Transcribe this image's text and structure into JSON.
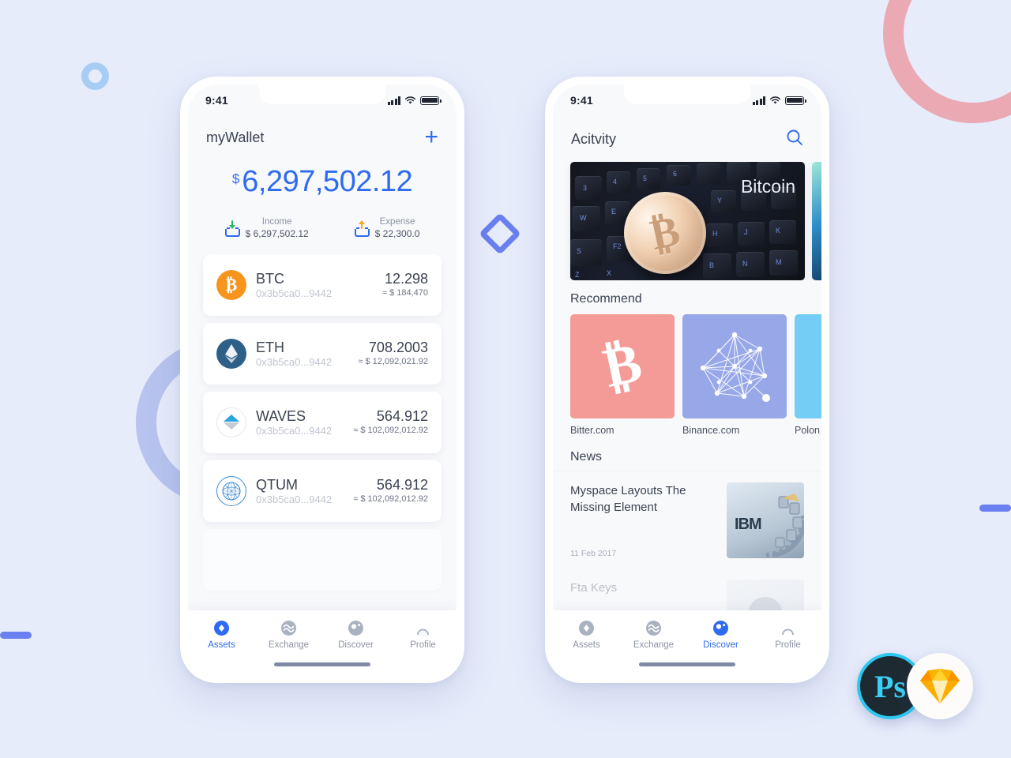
{
  "background": {
    "color": "#e7ecfb",
    "decorations": [
      {
        "name": "ring-pink",
        "color": "#eaa9b3"
      },
      {
        "name": "ring-blue-small",
        "color": "#a8cdf4"
      },
      {
        "name": "ring-periwinkle",
        "color": "#b8c4ef"
      },
      {
        "name": "bar-left",
        "color": "#6a7ff0"
      },
      {
        "name": "bar-right",
        "color": "#6a7ff0"
      },
      {
        "name": "diamond",
        "color": "#6a7ff0"
      }
    ]
  },
  "badges": [
    {
      "name": "photoshop",
      "label": "Ps"
    },
    {
      "name": "sketch",
      "label": "Sketch"
    }
  ],
  "phone1": {
    "status": {
      "time": "9:41"
    },
    "header": {
      "title": "myWallet",
      "add_label": "+"
    },
    "balance": {
      "currency": "$",
      "amount": "6,297,502.12"
    },
    "summary": [
      {
        "label": "Income",
        "value": "$ 6,297,502.12",
        "direction": "down",
        "color": "#28b865"
      },
      {
        "label": "Expense",
        "value": "$ 22,300.0",
        "direction": "up",
        "color": "#f5a623"
      }
    ],
    "assets": [
      {
        "symbol": "BTC",
        "address": "0x3b5ca0...9442",
        "amount": "12.298",
        "fiat": "≈ $ 184,470",
        "icon": "bitcoin-icon"
      },
      {
        "symbol": "ETH",
        "address": "0x3b5ca0...9442",
        "amount": "708.2003",
        "fiat": "≈ $ 12,092,021.92",
        "icon": "ethereum-icon"
      },
      {
        "symbol": "WAVES",
        "address": "0x3b5ca0...9442",
        "amount": "564.912",
        "fiat": "≈ $ 102,092,012.92",
        "icon": "waves-icon"
      },
      {
        "symbol": "QTUM",
        "address": "0x3b5ca0...9442",
        "amount": "564.912",
        "fiat": "≈ $ 102,092,012.92",
        "icon": "qtum-icon"
      }
    ],
    "tabs": [
      {
        "label": "Assets",
        "icon": "assets-icon",
        "active": true
      },
      {
        "label": "Exchange",
        "icon": "exchange-icon",
        "active": false
      },
      {
        "label": "Discover",
        "icon": "discover-icon",
        "active": false
      },
      {
        "label": "Profile",
        "icon": "profile-icon",
        "active": false
      }
    ]
  },
  "phone2": {
    "status": {
      "time": "9:41"
    },
    "header": {
      "title": "Acitvity",
      "search_icon": "search-icon"
    },
    "banners": [
      {
        "caption": "Bitcoin",
        "style": "keyboard-bitcoin"
      },
      {
        "caption": "",
        "style": "teal"
      }
    ],
    "recommend": {
      "title": "Recommend",
      "items": [
        {
          "name": "Bitter.com",
          "color": "#f59b97",
          "icon": "bitcoin-glyph"
        },
        {
          "name": "Binance.com",
          "color": "#97a7e8",
          "icon": "network-glyph"
        },
        {
          "name": "Polon",
          "color": "#74cdf4",
          "icon": "partial-glyph"
        }
      ]
    },
    "news": {
      "title": "News",
      "items": [
        {
          "title": "Myspace Layouts The Missing Element",
          "date": "11 Feb 2017",
          "thumb": "ibm-server"
        },
        {
          "title": "Fta Keys",
          "date": "",
          "thumb": "avatar"
        }
      ]
    },
    "tabs": [
      {
        "label": "Assets",
        "icon": "assets-icon",
        "active": false
      },
      {
        "label": "Exchange",
        "icon": "exchange-icon",
        "active": false
      },
      {
        "label": "Discover",
        "icon": "discover-icon",
        "active": true
      },
      {
        "label": "Profile",
        "icon": "profile-icon",
        "active": false
      }
    ]
  }
}
